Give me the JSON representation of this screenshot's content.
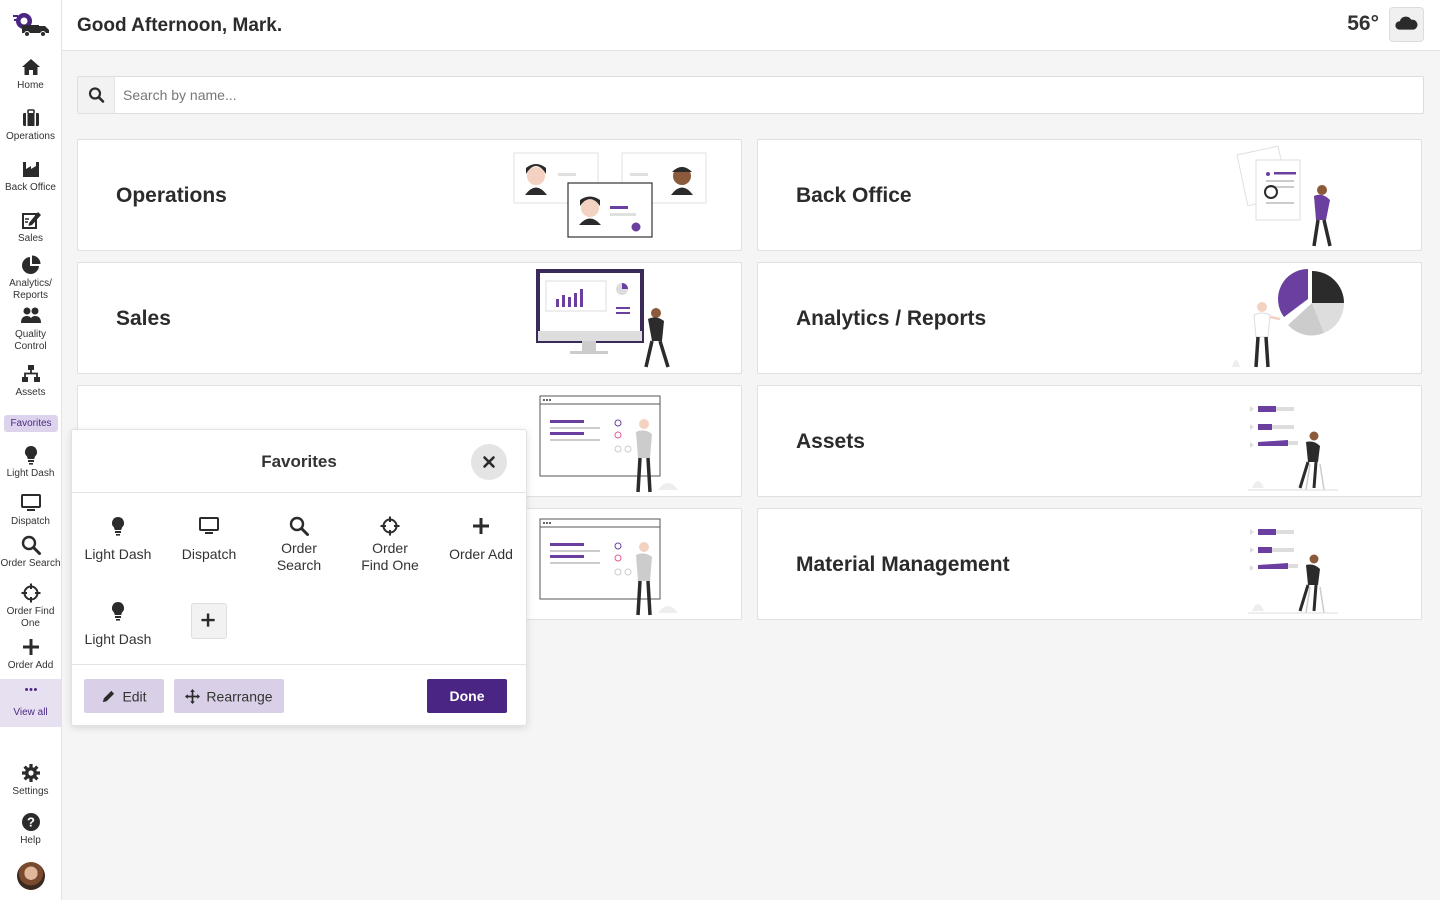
{
  "header": {
    "greeting": "Good Afternoon, Mark.",
    "temperature": "56°",
    "weather_icon": "cloud-icon"
  },
  "search": {
    "placeholder": "Search by name...",
    "value": ""
  },
  "sidebar": {
    "logo": "delivery-truck-logo",
    "items": [
      {
        "label": "Home",
        "icon": "home-icon"
      },
      {
        "label": "Operations",
        "icon": "briefcase-icon"
      },
      {
        "label": "Back Office",
        "icon": "factory-icon"
      },
      {
        "label": "Sales",
        "icon": "edit-icon"
      },
      {
        "label": "Analytics/ Reports",
        "icon": "pie-chart-icon"
      },
      {
        "label": "Quality Control",
        "icon": "users-icon"
      },
      {
        "label": "Assets",
        "icon": "sitemap-icon"
      }
    ],
    "favorites_label": "Favorites",
    "favorites": [
      {
        "label": "Light Dash",
        "icon": "lightbulb-icon"
      },
      {
        "label": "Dispatch",
        "icon": "monitor-icon"
      },
      {
        "label": "Order Search",
        "icon": "search-icon"
      },
      {
        "label": "Order Find One",
        "icon": "crosshair-icon"
      },
      {
        "label": "Order Add",
        "icon": "plus-icon"
      }
    ],
    "view_all": "View all",
    "settings": "Settings",
    "help": "Help"
  },
  "cards": [
    {
      "title": "Operations"
    },
    {
      "title": "Back Office"
    },
    {
      "title": "Sales"
    },
    {
      "title": "Analytics / Reports"
    },
    {
      "title": ""
    },
    {
      "title": "Assets"
    },
    {
      "title": ""
    },
    {
      "title": "Material Management"
    }
  ],
  "favorites_panel": {
    "title": "Favorites",
    "items": [
      {
        "label": "Light Dash",
        "icon": "lightbulb-icon"
      },
      {
        "label": "Dispatch",
        "icon": "monitor-icon"
      },
      {
        "label": "Order Search",
        "icon": "search-icon"
      },
      {
        "label": "Order Find One",
        "icon": "crosshair-icon"
      },
      {
        "label": "Order Add",
        "icon": "plus-icon"
      },
      {
        "label": "Light Dash",
        "icon": "lightbulb-icon"
      }
    ],
    "edit_label": "Edit",
    "rearrange_label": "Rearrange",
    "done_label": "Done"
  },
  "colors": {
    "brand": "#4a2584",
    "accent_light": "#d9d0e8",
    "illustration_purple": "#6b3fa0"
  }
}
